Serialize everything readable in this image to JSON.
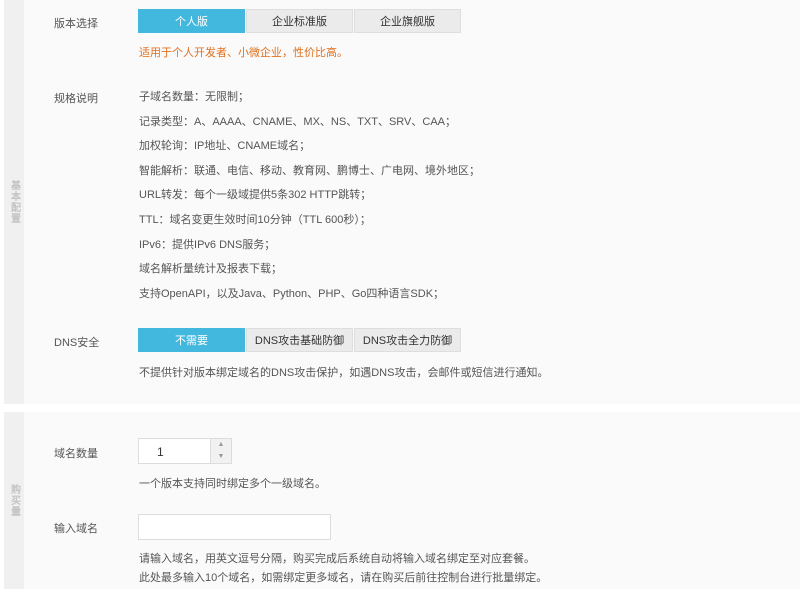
{
  "side_tabs": {
    "basic": "基本配置",
    "buy": "购买量"
  },
  "version": {
    "label": "版本选择",
    "options": [
      "个人版",
      "企业标准版",
      "企业旗舰版"
    ],
    "selected_index": 0,
    "note": "适用于个人开发者、小微企业，性价比高。"
  },
  "specs": {
    "label": "规格说明",
    "items": [
      "子域名数量：无限制；",
      "记录类型：A、AAAA、CNAME、MX、NS、TXT、SRV、CAA；",
      "加权轮询：IP地址、CNAME域名；",
      "智能解析：联通、电信、移动、教育网、鹏博士、广电网、境外地区；",
      "URL转发：每个一级域提供5条302 HTTP跳转；",
      "TTL：域名变更生效时间10分钟（TTL 600秒）；",
      "IPv6：提供IPv6 DNS服务；",
      "域名解析量统计及报表下载；",
      "支持OpenAPI，以及Java、Python、PHP、Go四种语言SDK；"
    ]
  },
  "dns_security": {
    "label": "DNS安全",
    "options": [
      "不需要",
      "DNS攻击基础防御",
      "DNS攻击全力防御"
    ],
    "selected_index": 0,
    "note": "不提供针对版本绑定域名的DNS攻击保护，如遇DNS攻击，会邮件或短信进行通知。"
  },
  "domain_count": {
    "label": "域名数量",
    "value": "1",
    "hint": "一个版本支持同时绑定多个一级域名。"
  },
  "domain_input": {
    "label": "输入域名",
    "value": "",
    "hint1": "请输入域名，用英文逗号分隔，购买完成后系统自动将输入域名绑定至对应套餐。",
    "hint2": "此处最多输入10个域名，如需绑定更多域名，请在购买后前往控制台进行批量绑定。"
  },
  "colors": {
    "accent": "#42b8de",
    "note_orange": "#e0701e"
  }
}
